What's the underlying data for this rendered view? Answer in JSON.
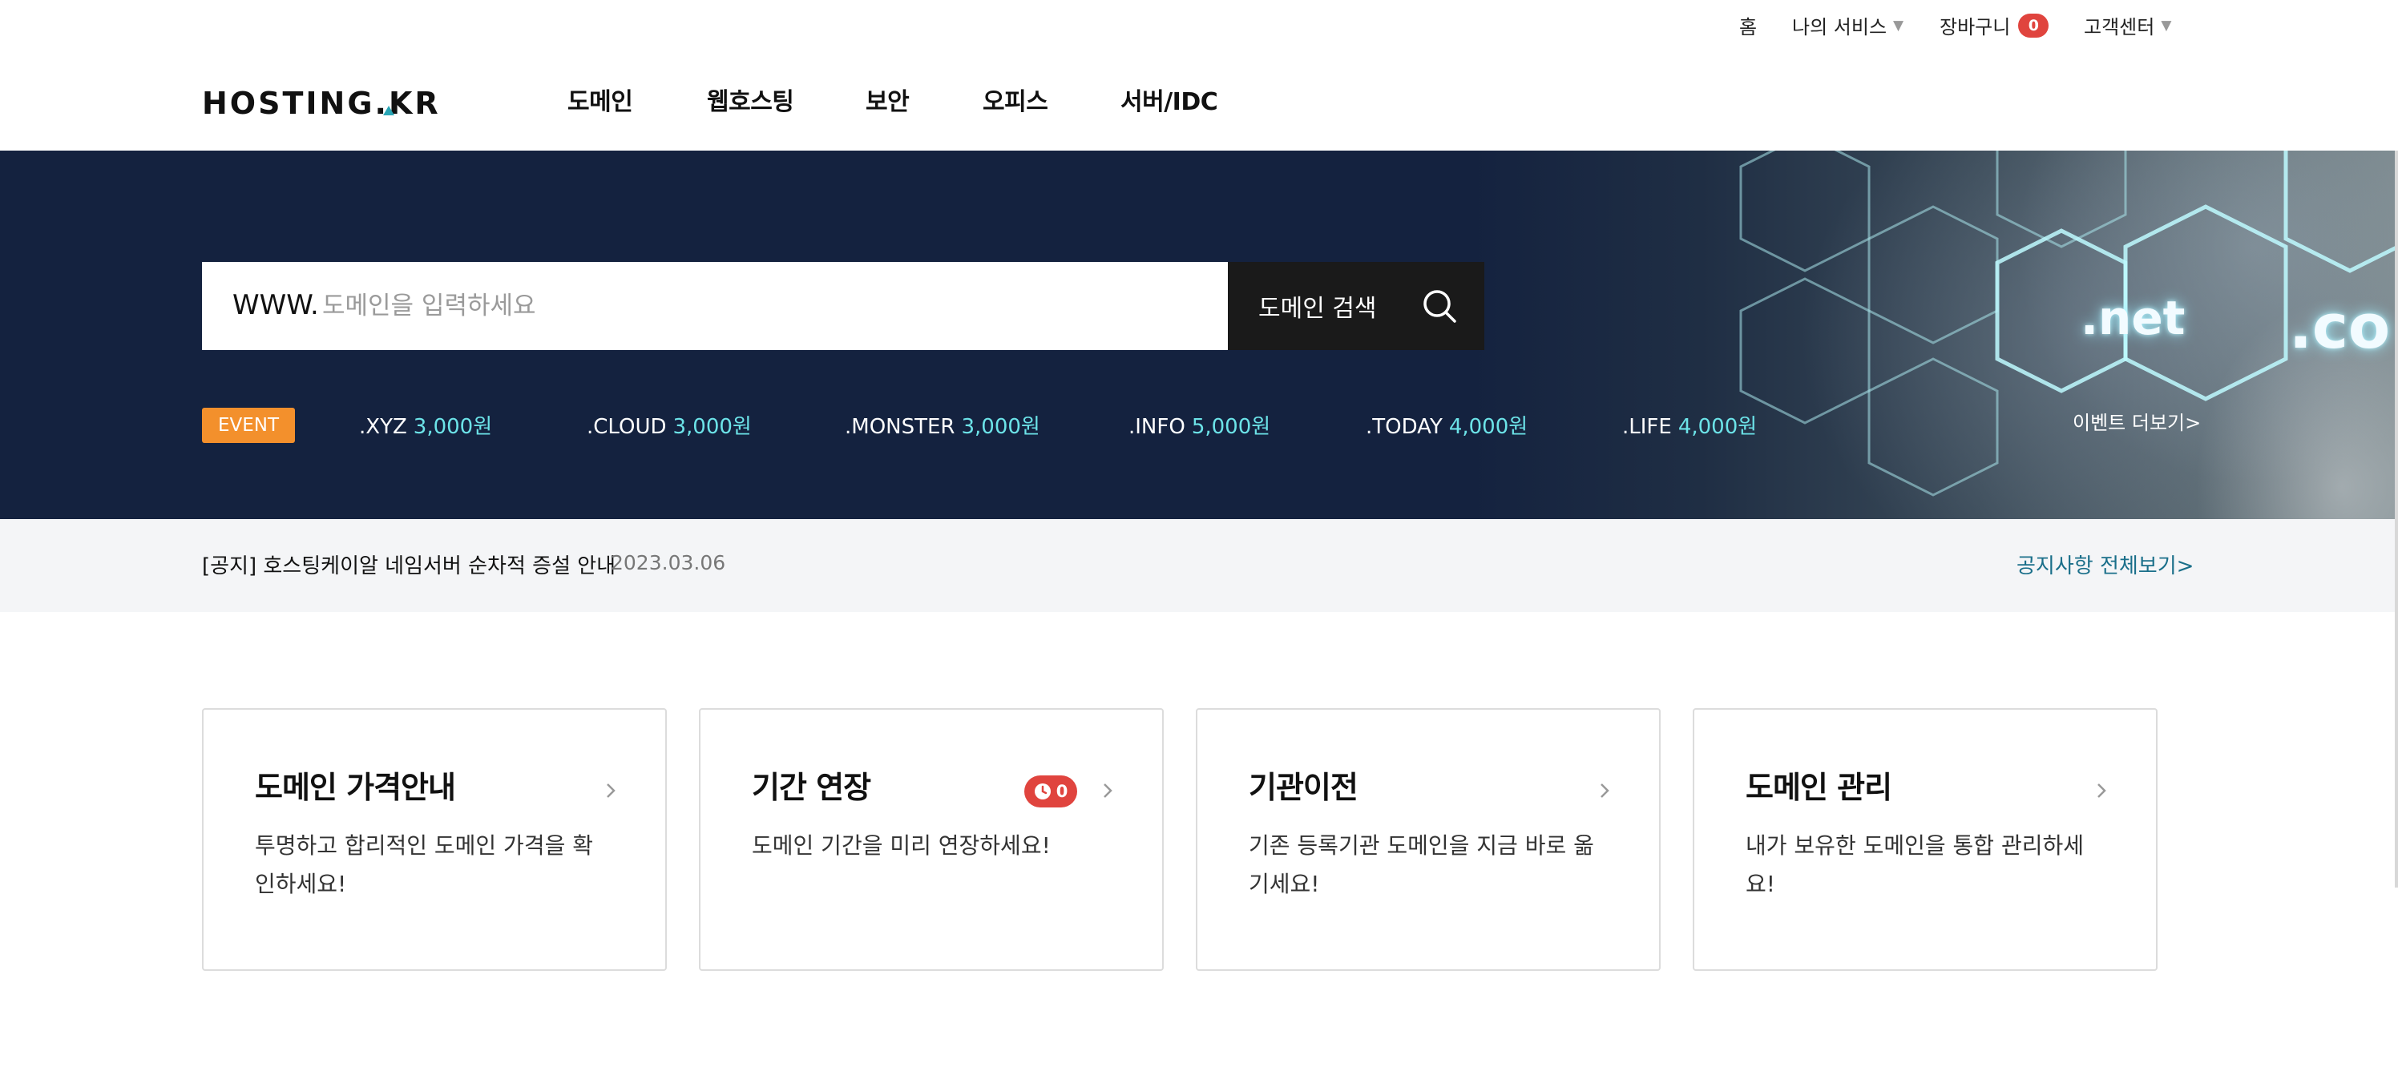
{
  "util_nav": {
    "home": "홈",
    "my_services": "나의 서비스",
    "cart": "장바구니",
    "cart_count": "0",
    "support": "고객센터"
  },
  "header": {
    "logo_text": "HOSTING.KR",
    "nav": [
      "도메인",
      "웹호스팅",
      "보안",
      "오피스",
      "서버/IDC"
    ]
  },
  "hero": {
    "search_prefix": "WWW.",
    "search_placeholder": "도메인을 입력하세요",
    "search_value": "",
    "search_button": "도메인 검색",
    "event_badge": "EVENT",
    "events": [
      {
        "tld": ".XYZ",
        "price": "3,000원"
      },
      {
        "tld": ".CLOUD",
        "price": "3,000원"
      },
      {
        "tld": ".MONSTER",
        "price": "3,000원"
      },
      {
        "tld": ".INFO",
        "price": "5,000원"
      },
      {
        "tld": ".TODAY",
        "price": "4,000원"
      },
      {
        "tld": ".LIFE",
        "price": "4,000원"
      }
    ],
    "event_more": "이벤트 더보기>",
    "image_text_net": ".net",
    "image_text_co": ".co"
  },
  "notice": {
    "text": "[공지] 호스팅케이알 네임서버 순차적 증설 안내",
    "date": "2023.03.06",
    "view_all": "공지사항 전체보기>"
  },
  "cards": [
    {
      "title": "도메인 가격안내",
      "desc": "투명하고 합리적인 도메인 가격을 확인하세요!"
    },
    {
      "title": "기간 연장",
      "desc": "도메인 기간을 미리 연장하세요!",
      "badge": "0"
    },
    {
      "title": "기관이전",
      "desc": "기존 등록기관 도메인을 지금 바로 옮기세요!"
    },
    {
      "title": "도메인 관리",
      "desc": "내가 보유한 도메인을 통합 관리하세요!"
    }
  ],
  "colors": {
    "hero_bg": "#14223f",
    "event_orange": "#f3902c",
    "price_cyan": "#6ce3e8",
    "badge_red": "#e0443e",
    "notice_link": "#1a6f8a"
  }
}
